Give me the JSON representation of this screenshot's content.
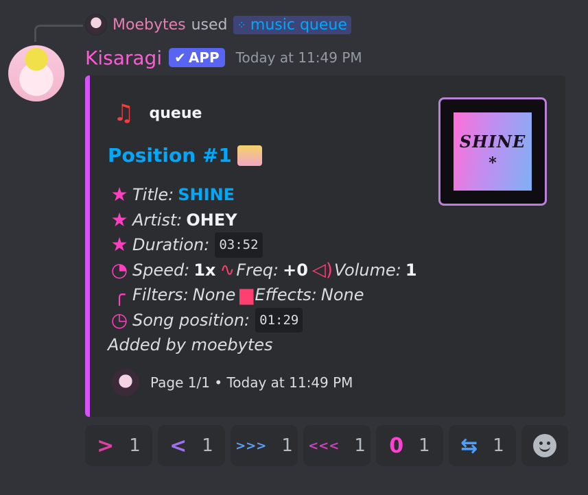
{
  "reply": {
    "user": "Moebytes",
    "used": "used",
    "command": "music queue"
  },
  "message": {
    "username": "Kisaragi",
    "badge": "APP",
    "timestamp": "Today at 11:49 PM"
  },
  "embed": {
    "author": "queue",
    "title": "Position #1",
    "thumbnail_text": "SHINE",
    "fields": {
      "title_label": "Title:",
      "title_value": "SHINE",
      "artist_label": "Artist:",
      "artist_value": "OHEY",
      "duration_label": "Duration:",
      "duration_value": "03:52",
      "speed_label": "Speed:",
      "speed_value": "1x",
      "freq_label": "Freq:",
      "freq_value": "+0",
      "volume_label": "Volume:",
      "volume_value": "1",
      "filters_label": "Filters:",
      "filters_value": "None",
      "effects_label": "Effects:",
      "effects_value": "None",
      "position_label": "Song position:",
      "position_value": "01:29",
      "added_by": "Added by moebytes"
    },
    "footer": "Page 1/1 • Today at 11:49 PM"
  },
  "reactions": [
    {
      "icon": "next-arrow-icon",
      "glyph": ">",
      "color": "#e040a0",
      "count": "1"
    },
    {
      "icon": "prev-arrow-icon",
      "glyph": "<",
      "color": "#a070f0",
      "count": "1"
    },
    {
      "icon": "fast-forward-icon",
      "glyph": ">>>",
      "color": "#5aa0ff",
      "count": "1"
    },
    {
      "icon": "rewind-icon",
      "glyph": "<<<",
      "color": "#d040c0",
      "count": "1"
    },
    {
      "icon": "zero-icon",
      "glyph": "0",
      "color": "#ff40d0",
      "count": "1"
    },
    {
      "icon": "loop-icon",
      "glyph": "⇆",
      "color": "#4aa0ff",
      "count": "1"
    }
  ],
  "colors": {
    "background": "#313338",
    "embed_bar": "#d553f9",
    "link": "#00a8fc",
    "username": "#ff5bd6",
    "accent_pink": "#ff3fc0"
  }
}
